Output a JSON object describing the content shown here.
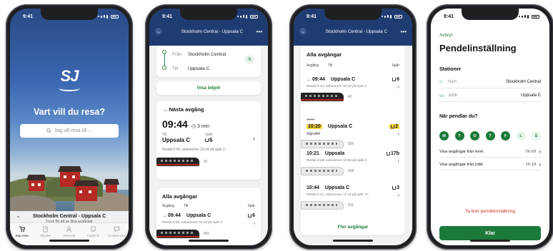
{
  "status": {
    "time": "9:41"
  },
  "screen1": {
    "logo": "SJ",
    "headline": "Vart vill du resa?",
    "search_placeholder": "Jag vill resa till ...",
    "trip_title": "Stockholm Central - Uppsala C",
    "trip_subtitle": "Tryck för att se dina avgångar",
    "tabs": [
      "Köp resa",
      "Biljetter",
      "Resenär",
      "Trafikinfo",
      "Kundservice"
    ]
  },
  "screen2": {
    "header": "Stockholm Central - Uppsala C",
    "from_label": "Från",
    "from_value": "Stockholm Central",
    "to_label": "Till",
    "to_value": "Uppsala C",
    "show_ticket": "Visa biljett",
    "next_title": "Nästa avgång",
    "next_time": "09:44",
    "next_in": "3 min",
    "to_small": "Till",
    "track_small": "Spår",
    "next_dest": "Uppsala C",
    "next_track": "6",
    "next_info": "Restid 0:40, ankommer 10:24 på spår 2",
    "next_train": "42",
    "all_title": "Alla avgångar",
    "col_dep": "Avgång",
    "col_to": "Till",
    "col_track": "Spår",
    "row_time": "09:44",
    "row_dest": "Uppsala C",
    "row_track": "6",
    "row_info": "Restid 0:40, ankommer 10:24 på spår 2",
    "row_train": "401"
  },
  "screen3": {
    "header": "Stockholm Central - Uppsala C",
    "title": "Alla avgångar",
    "col_dep": "Avgång",
    "col_to": "Till",
    "col_track": "Spår",
    "more": "Fler avgångar",
    "rows": [
      {
        "time": "09:44",
        "dest": "Uppsala C",
        "track": "6",
        "info": "Restid 0:40, ankommer 10:24 på spår 2",
        "train": "42"
      },
      {
        "old_time": "10:09",
        "time": "10:20",
        "dest": "Uppsala C",
        "track": "2",
        "info": "Signalfel",
        "train": "820"
      },
      {
        "time": "10:21",
        "dest": "Uppsala",
        "track": "17b",
        "info": "Restid 0:38, ankommer 10:59 på spår 2",
        "train": "268"
      },
      {
        "time": "10:44",
        "dest": "Uppsala C",
        "track": "3",
        "info": "Restid 0:31, ankommer 11:15 på spår 7n",
        "train": "811"
      }
    ]
  },
  "screen4": {
    "back": "Avbryt",
    "title": "Pendelinställning",
    "stations_title": "Stationer",
    "home_label": "Hem",
    "home_value": "Stockholm Central",
    "work_label": "Jobb",
    "work_value": "Uppsala C",
    "days_title": "När pendlar du?",
    "days": [
      {
        "l": "M",
        "on": true
      },
      {
        "l": "T",
        "on": true
      },
      {
        "l": "O",
        "on": true
      },
      {
        "l": "T",
        "on": true
      },
      {
        "l": "F",
        "on": true
      },
      {
        "l": "L",
        "on": false
      },
      {
        "l": "S",
        "on": false
      }
    ],
    "from_home_label": "Visa avgångar från hem",
    "from_home_value": "06-09",
    "from_work_label": "Visa avgångar från jobb",
    "from_work_value": "15-18",
    "remove": "Ta bort pendelinställning",
    "done": "Klar"
  },
  "colors": {
    "brand_green": "#1b7a3a",
    "navy": "#1f3c72",
    "alert_yellow": "#f5d33c",
    "danger": "#c9332c"
  }
}
